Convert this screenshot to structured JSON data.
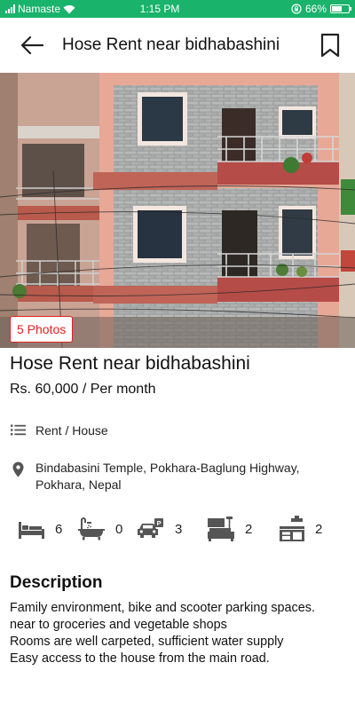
{
  "status_bar": {
    "carrier": "Namaste",
    "time": "1:15 PM",
    "battery": "66%",
    "battery_level": 0.66
  },
  "app_bar": {
    "title": "Hose Rent near bidhabashini",
    "back_icon": "arrow-left-icon",
    "bookmark_icon": "bookmark-icon"
  },
  "listing": {
    "photos_label": "5 Photos",
    "title": "Hose Rent near bidhabashini",
    "price": "Rs. 60,000 / Per month",
    "category": "Rent / House",
    "address_line1": "Bindabasini Temple, Pokhara-Baglung Highway,",
    "address_line2": "Pokhara, Nepal",
    "features": [
      {
        "icon": "bed-icon",
        "value": "6"
      },
      {
        "icon": "bathtub-icon",
        "value": "0"
      },
      {
        "icon": "car-parking-icon",
        "value": "3"
      },
      {
        "icon": "living-room-icon",
        "value": "2"
      },
      {
        "icon": "kitchen-icon",
        "value": "2"
      }
    ]
  },
  "description": {
    "heading": "Description",
    "lines": [
      "Family environment, bike and scooter parking spaces.",
      "near to groceries and vegetable shops",
      "Rooms are well carpeted, sufficient water supply",
      "Easy access to the house from the main road."
    ]
  },
  "colors": {
    "status_bar": "#19b36b",
    "badge_red": "#e02020",
    "icon_gray": "#555555"
  }
}
